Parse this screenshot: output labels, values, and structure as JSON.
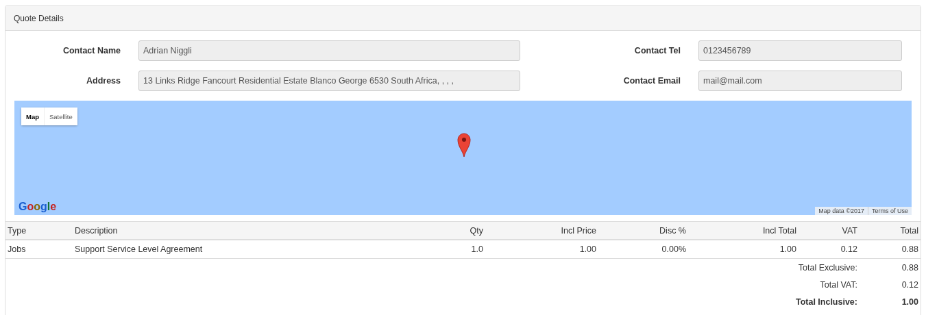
{
  "panel": {
    "title": "Quote Details"
  },
  "fields": [
    {
      "label": "Contact Name",
      "value": "Adrian Niggli"
    },
    {
      "label": "Contact Tel",
      "value": "0123456789"
    },
    {
      "label": "Address",
      "value": "13 Links Ridge Fancourt Residential Estate Blanco George 6530 South Africa, , , ,"
    },
    {
      "label": "Contact Email",
      "value": "mail@mail.com"
    }
  ],
  "map": {
    "types": [
      {
        "label": "Map",
        "selected": true
      },
      {
        "label": "Satellite",
        "selected": false
      }
    ],
    "logo": "Google",
    "attribution": "Map data ©2017",
    "terms": "Terms of Use"
  },
  "table": {
    "columns": [
      "Type",
      "Description",
      "Qty",
      "Incl Price",
      "Disc %",
      "Incl Total",
      "VAT",
      "Total"
    ],
    "rows": [
      [
        "Jobs",
        "Support Service Level Agreement",
        "1.0",
        "1.00",
        "0.00%",
        "1.00",
        "0.12",
        "0.88"
      ]
    ],
    "totals": [
      {
        "label": "Total Exclusive:",
        "value": "0.88",
        "bold": false
      },
      {
        "label": "Total VAT:",
        "value": "0.12",
        "bold": false
      },
      {
        "label": "Total Inclusive:",
        "value": "1.00",
        "bold": true
      }
    ]
  }
}
